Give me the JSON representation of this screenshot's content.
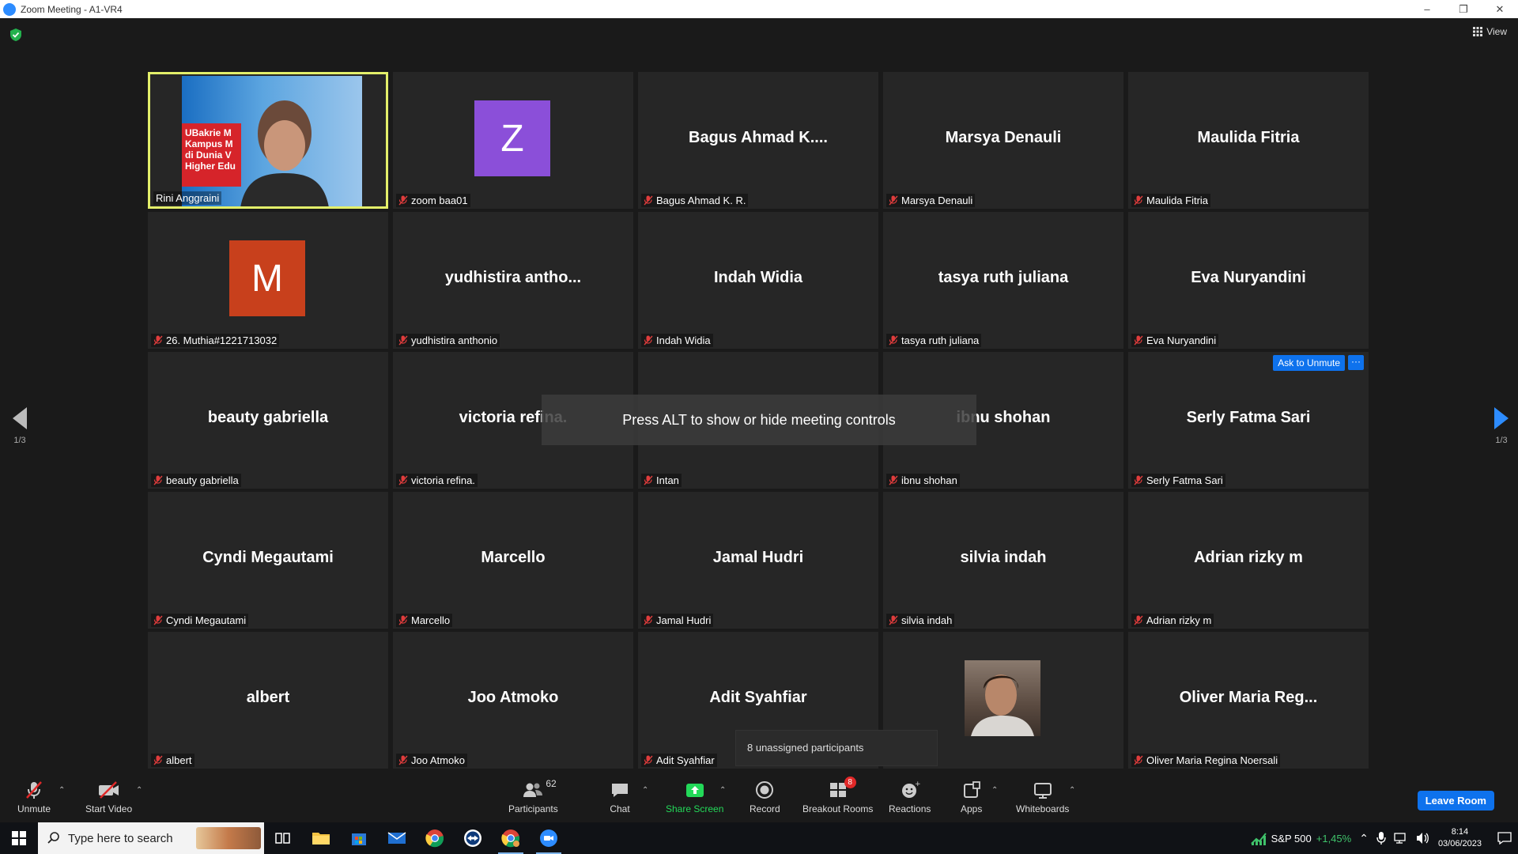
{
  "window": {
    "title": "Zoom Meeting - A1-VR4",
    "min": "–",
    "restore": "❐",
    "close": "✕"
  },
  "top": {
    "view_label": "View"
  },
  "tiles": [
    {
      "type": "video",
      "big": "",
      "label": "Rini Anggraini",
      "muted": false,
      "active": true,
      "banner": "UBakrie M\nKampus M\ndi Dunia V\nHigher Edu"
    },
    {
      "type": "avatar",
      "avatar_letter": "Z",
      "avatar_color": "#8b4fd9",
      "label": "zoom baa01",
      "muted": true
    },
    {
      "type": "name",
      "big": "Bagus  Ahmad  K....",
      "label": "Bagus Ahmad K. R.",
      "muted": true
    },
    {
      "type": "name",
      "big": "Marsya Denauli",
      "label": "Marsya Denauli",
      "muted": true
    },
    {
      "type": "name",
      "big": "Maulida Fitria",
      "label": "Maulida Fitria",
      "muted": true
    },
    {
      "type": "avatar",
      "avatar_letter": "M",
      "avatar_color": "#c8401c",
      "label": "26. Muthia#1221713032",
      "muted": true
    },
    {
      "type": "name",
      "big": "yudhistira  antho...",
      "label": "yudhistira anthonio",
      "muted": true
    },
    {
      "type": "name",
      "big": "Indah Widia",
      "label": "Indah Widia",
      "muted": true
    },
    {
      "type": "name",
      "big": "tasya ruth juliana",
      "label": "tasya ruth juliana",
      "muted": true
    },
    {
      "type": "name",
      "big": "Eva Nuryandini",
      "label": "Eva Nuryandini",
      "muted": true
    },
    {
      "type": "name",
      "big": "beauty gabriella",
      "label": "beauty gabriella",
      "muted": true
    },
    {
      "type": "name",
      "big": "victoria refina.",
      "label": "victoria refina.",
      "muted": true
    },
    {
      "type": "name",
      "big": "",
      "label": "Intan",
      "muted": true
    },
    {
      "type": "name",
      "big": "ibnu shohan",
      "label": "ibnu shohan",
      "muted": true
    },
    {
      "type": "name",
      "big": "Serly Fatma Sari",
      "label": "Serly Fatma Sari",
      "muted": true,
      "hover": true
    },
    {
      "type": "name",
      "big": "Cyndi Megautami",
      "label": "Cyndi Megautami",
      "muted": true
    },
    {
      "type": "name",
      "big": "Marcello",
      "label": "Marcello",
      "muted": true
    },
    {
      "type": "name",
      "big": "Jamal Hudri",
      "label": "Jamal Hudri",
      "muted": true
    },
    {
      "type": "name",
      "big": "silvia indah",
      "label": "silvia indah",
      "muted": true
    },
    {
      "type": "name",
      "big": "Adrian rizky m",
      "label": "Adrian rizky m",
      "muted": true
    },
    {
      "type": "name",
      "big": "albert",
      "label": "albert",
      "muted": true
    },
    {
      "type": "name",
      "big": "Joo Atmoko",
      "label": "Joo Atmoko",
      "muted": true
    },
    {
      "type": "name",
      "big": "Adit Syahfiar",
      "label": "Adit Syahfiar",
      "muted": true
    },
    {
      "type": "photo",
      "big": "",
      "label": "",
      "muted": false
    },
    {
      "type": "name",
      "big": "Oliver  Maria  Reg...",
      "label": "Oliver Maria Regina Noersali",
      "muted": true
    }
  ],
  "hover_actions": {
    "ask_unmute": "Ask to Unmute",
    "more": "···"
  },
  "hint": "Press ALT to show or hide meeting controls",
  "pager": {
    "left": "1/3",
    "right": "1/3"
  },
  "unassigned": "8 unassigned participants",
  "toolbar": {
    "unmute": "Unmute",
    "start_video": "Start Video",
    "participants": "Participants",
    "participants_count": "62",
    "chat": "Chat",
    "share_screen": "Share Screen",
    "record": "Record",
    "breakout_rooms": "Breakout Rooms",
    "breakout_badge": "8",
    "reactions": "Reactions",
    "apps": "Apps",
    "whiteboards": "Whiteboards",
    "leave": "Leave Room",
    "share_color": "#23d959"
  },
  "taskbar": {
    "search_placeholder": "Type here to search",
    "stock_name": "S&P 500",
    "stock_change": "+1,45%",
    "time": "8:14",
    "date": "03/06/2023"
  }
}
